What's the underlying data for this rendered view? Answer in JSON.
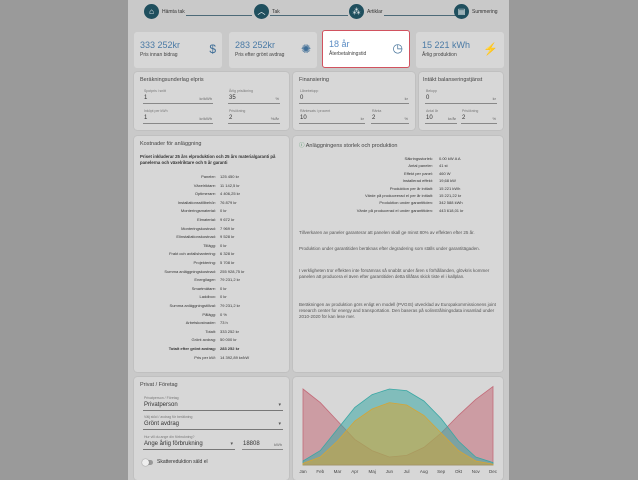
{
  "stepper": {
    "steps": [
      {
        "label": "Hämta tak",
        "icon": "home-icon"
      },
      {
        "label": "Tak",
        "icon": "chevron-up-icon"
      },
      {
        "label": "Artiklar",
        "icon": "items-icon"
      },
      {
        "label": "Summering",
        "icon": "clipboard-icon"
      }
    ]
  },
  "kpis": [
    {
      "value": "333 252kr",
      "label": "Pris innan bidrag",
      "icon": "dollar-icon"
    },
    {
      "value": "283 252kr",
      "label": "Pris efter grönt avdrag",
      "icon": "discount-badge-icon"
    },
    {
      "value": "18 år",
      "label": "Återbetalningstid",
      "icon": "clock-icon"
    },
    {
      "value": "15 221 kWh",
      "label": "Årlig produktion",
      "icon": "solar-panel-icon"
    }
  ],
  "pricing": {
    "title": "Beräkningsunderlag elpris",
    "fields": [
      {
        "label": "Spotpris i snitt",
        "value": "1",
        "unit": "kr/kWh"
      },
      {
        "label": "Årlig prisökning",
        "value": "35",
        "unit": "%"
      },
      {
        "label": "Inköpt per kWh",
        "value": "1",
        "unit": "kr/kWh"
      },
      {
        "label": "Prisökning",
        "value": "2",
        "unit": "%/år"
      }
    ]
  },
  "financing": {
    "title": "Finansiering",
    "fields": [
      {
        "label": "Lånebelopp",
        "value": "0",
        "unit": "kr"
      },
      {
        "label": "Räntesats i procent",
        "value": "10",
        "unit": "kr"
      },
      {
        "label": "Ränta",
        "value": "2",
        "unit": "%"
      }
    ]
  },
  "balancing": {
    "title": "Intäkt balanseringstjänst",
    "fields": [
      {
        "label": "Belopp",
        "value": "0",
        "unit": "kr"
      },
      {
        "label": "Antal år",
        "value": "10",
        "unit": "kr/år"
      },
      {
        "label": "Prisökning",
        "value": "2",
        "unit": "%"
      }
    ]
  },
  "costs": {
    "title": "Kostnader för anläggning",
    "note": "Priset inkluderar 25 års elproduktion och 25 års materialgaranti på panelerna och växelriktare och 5 år garanti",
    "rows": [
      {
        "k": "Paneler:",
        "v": "125 450 kr"
      },
      {
        "k": "Växelriktare:",
        "v": "11 142,5 kr"
      },
      {
        "k": "Optimerare:",
        "v": "4 406,25 kr"
      },
      {
        "k": "Installationsstillbehör:",
        "v": "76 879 kr"
      },
      {
        "k": "Monteringsmaterial:",
        "v": "0 kr"
      },
      {
        "k": "Elmaterial:",
        "v": "9 672 kr"
      },
      {
        "k": "Monteringskostnad:",
        "v": "7 969 kr"
      },
      {
        "k": "Elinstallationskostnad:",
        "v": "9 528 kr"
      },
      {
        "k": "Tillägg:",
        "v": "0 kr"
      },
      {
        "k": "Frakt och avfallshantering:",
        "v": "6 328 kr"
      },
      {
        "k": "Projektering:",
        "v": "5 708 kr"
      },
      {
        "k": "Summa anläggningskostnad:",
        "v": "255 928,75 kr"
      },
      {
        "k": "Energilager:",
        "v": "79 231,2 kr"
      },
      {
        "k": "Smartmätare:",
        "v": "0 kr"
      },
      {
        "k": "Laddbox:",
        "v": "0 kr"
      },
      {
        "k": "Summa anläggningstillval:",
        "v": "79 231,2 kr"
      },
      {
        "k": "Pålägg:",
        "v": "0 %"
      },
      {
        "k": "Arbetskostnader:",
        "v": "73 h"
      },
      {
        "k": "Totalt:",
        "v": "333 252 kr"
      },
      {
        "k": "Grönt avdrag:",
        "v": "50 000 kr"
      },
      {
        "k": "Totalt efter grönt avdrag:",
        "v": "283 252 kr"
      },
      {
        "k": "Pris per kW:",
        "v": "14 392,89 kr/kW"
      }
    ]
  },
  "production": {
    "title": "Anläggningens storlek och produktion",
    "rows": [
      {
        "k": "Säkringsstorlek:",
        "v": "0.00 kW A A"
      },
      {
        "k": "Antal paneler:",
        "v": "41 st"
      },
      {
        "k": "Effekt per panel:",
        "v": "460 W"
      },
      {
        "k": "Installerad effekt:",
        "v": "19,68 kW"
      },
      {
        "k": "Produktion per år initialt:",
        "v": "15 221 kWh"
      },
      {
        "k": "Värde på produceerad el per år initialt:",
        "v": "15 221,22 kr"
      },
      {
        "k": "Produktion under garantitiden:",
        "v": "342 588 kWh"
      },
      {
        "k": "Värde på producerad el under garantitiden:",
        "v": "443 618,01 kr"
      }
    ],
    "paragraphs": [
      "Tillverkaren av paneler garanterar att panelen skall ge minst 80% av effekten efter 25 år.",
      "Produktion under garantitiden beräknas efter degradering som ställs under garantitägaden.",
      "I verkligheten tror effekten inte försämras så snabbt under åren s förhållanden, glövkris kommer panelen att producera el även efter garantitiden detta tillåtas skick tiste el i kallplan.",
      "Beräkningen av produktion görs enligt en modell (PVGIS) utvecklad av Europakommissionens joint research center for energy and transportation. Den baseras på solinstrålningsdata insamlad under 2010-2020 för kan lese mer."
    ]
  },
  "private": {
    "title": "Privat / Företag",
    "customer_type": {
      "label": "Privatperson / Företag",
      "value": "Privatperson"
    },
    "deduction": {
      "label": "Välj stöd / avdrag för beräkning",
      "value": "Grönt avdrag"
    },
    "consumption": {
      "label": "Hur vill du ange din förbrukning?",
      "value": "Ange årlig förbrukning"
    },
    "annual_kwh": {
      "value": "18808",
      "unit": "kWh"
    },
    "tax_toggle": "Skattereduktion säld el"
  },
  "chart_data": {
    "type": "area",
    "categories": [
      "Jan",
      "Feb",
      "Mar",
      "Apr",
      "Maj",
      "Jun",
      "Jul",
      "Aug",
      "Sep",
      "Okt",
      "Nov",
      "Dec"
    ],
    "series": [
      {
        "values": [
          95,
          78,
          55,
          32,
          18,
          10,
          12,
          22,
          40,
          62,
          82,
          98
        ],
        "color": "#c36b79"
      },
      {
        "values": [
          5,
          18,
          45,
          72,
          88,
          95,
          93,
          80,
          58,
          30,
          10,
          3
        ],
        "color": "#3aa7a4"
      },
      {
        "values": [
          2,
          10,
          30,
          55,
          70,
          78,
          75,
          62,
          40,
          18,
          5,
          1
        ],
        "color": "#d4a537"
      }
    ]
  }
}
